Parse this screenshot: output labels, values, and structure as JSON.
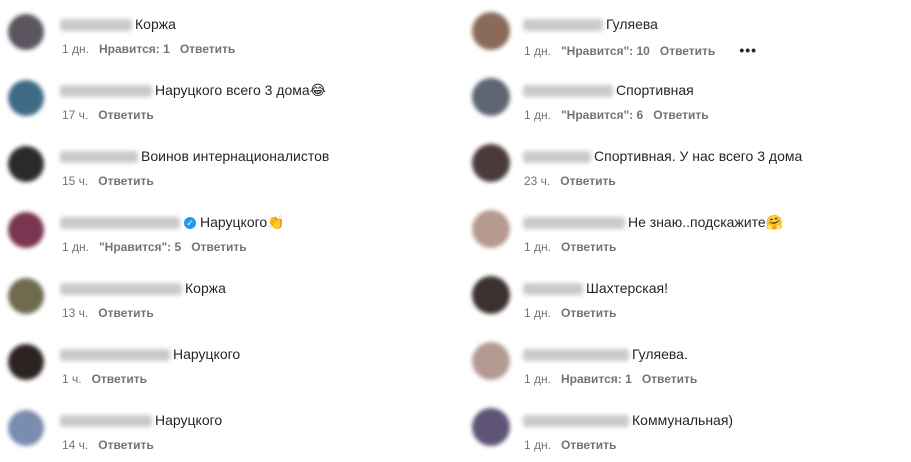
{
  "left": [
    {
      "text": "Коржа",
      "time": "1 дн.",
      "likes": "Нравится: 1",
      "reply": "Ответить",
      "verified": false,
      "avatar": "#5b5560"
    },
    {
      "text": "Наруцкого всего 3 дома😂",
      "time": "17 ч.",
      "likes": "",
      "reply": "Ответить",
      "verified": false,
      "avatar": "#3d6b86"
    },
    {
      "text": "Воинов интернационалистов",
      "time": "15 ч.",
      "likes": "",
      "reply": "Ответить",
      "verified": false,
      "avatar": "#2a2a2a"
    },
    {
      "text": "Наруцкого👏",
      "time": "1 дн.",
      "likes": "\"Нравится\": 5",
      "reply": "Ответить",
      "verified": true,
      "avatar": "#7a3550"
    },
    {
      "text": "Коржа",
      "time": "13 ч.",
      "likes": "",
      "reply": "Ответить",
      "verified": false,
      "avatar": "#6f6b4e"
    },
    {
      "text": "Наруцкого",
      "time": "1 ч.",
      "likes": "",
      "reply": "Ответить",
      "verified": false,
      "avatar": "#2b2422"
    },
    {
      "text": "Наруцкого",
      "time": "14 ч.",
      "likes": "",
      "reply": "Ответить",
      "verified": false,
      "avatar": "#7a8db0"
    }
  ],
  "right": [
    {
      "text": "Гуляева",
      "time": "1 дн.",
      "likes": "\"Нравится\": 10",
      "reply": "Ответить",
      "more": "•••",
      "avatar": "#8a6a58"
    },
    {
      "text": "Спортивная",
      "time": "1 дн.",
      "likes": "\"Нравится\": 6",
      "reply": "Ответить",
      "more": "",
      "avatar": "#5d6570"
    },
    {
      "text": "Спортивная. У нас всего 3 дома",
      "time": "23 ч.",
      "likes": "",
      "reply": "Ответить",
      "more": "",
      "avatar": "#4a3a3a"
    },
    {
      "text": "Не знаю..подскажите🤗",
      "time": "1 дн.",
      "likes": "",
      "reply": "Ответить",
      "more": "",
      "avatar": "#b69a8f"
    },
    {
      "text": "Шахтерская!",
      "time": "1 дн.",
      "likes": "",
      "reply": "Ответить",
      "more": "",
      "avatar": "#3b3230"
    },
    {
      "text": "Гуляева.",
      "time": "1 дн.",
      "likes": "Нравится: 1",
      "reply": "Ответить",
      "more": "",
      "avatar": "#b49a92"
    },
    {
      "text": "Коммунальная)",
      "time": "1 дн.",
      "likes": "",
      "reply": "Ответить",
      "more": "",
      "avatar": "#5e5476"
    }
  ]
}
